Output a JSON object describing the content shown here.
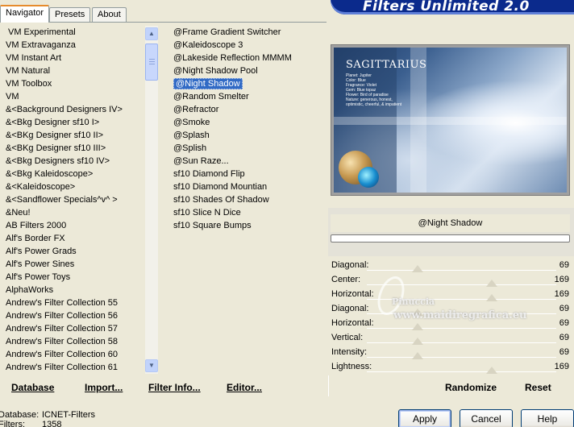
{
  "window": {
    "title": "Filters Unlimited 2.0"
  },
  "tabs": [
    {
      "label": "Navigator",
      "active": true
    },
    {
      "label": "Presets",
      "active": false
    },
    {
      "label": "About",
      "active": false
    }
  ],
  "categories": {
    "selected": "&<Background Designers IV>",
    "items": [
      "VM Experimental",
      "VM Extravaganza",
      "VM Instant Art",
      "VM Natural",
      "VM Toolbox",
      "VM",
      "&<Background Designers IV>",
      "&<Bkg Designer sf10 I>",
      "&<BKg Designer sf10 II>",
      "&<BKg Designer sf10 III>",
      "&<Bkg Designers sf10 IV>",
      "&<Bkg Kaleidoscope>",
      "&<Kaleidoscope>",
      "&<Sandflower Specials^v^ >",
      "&Neu!",
      "AB Filters 2000",
      "Alf's Border FX",
      "Alf's Power Grads",
      "Alf's Power Sines",
      "Alf's Power Toys",
      "AlphaWorks",
      "Andrew's Filter Collection 55",
      "Andrew's Filter Collection 56",
      "Andrew's Filter Collection 57",
      "Andrew's Filter Collection 58",
      "Andrew's Filter Collection 60",
      "Andrew's Filter Collection 61"
    ]
  },
  "filters": {
    "selected": "@Night Shadow",
    "items": [
      "@Frame Gradient Switcher",
      "@Kaleidoscope 3",
      "@Lakeside Reflection MMMM",
      "@Night Shadow Pool",
      "@Night Shadow",
      "@Random Smelter",
      "@Refractor",
      "@Smoke",
      "@Splash",
      "@Splish",
      "@Sun Raze...",
      "sf10 Diamond Flip",
      "sf10 Diamond Mountian",
      "sf10 Shades Of Shadow",
      "sf10 Slice N Dice",
      "sf10 Square Bumps"
    ]
  },
  "preview": {
    "title": "SAGITTARIUS",
    "text_lines": [
      "Planet: Jupiter",
      "Color: Blue",
      "Fragrance: Violet",
      "Gem: Blue topaz",
      "Flower: Bird of paradise",
      "Nature: generous, honest,",
      "optimistic, cheerful, & impatient"
    ]
  },
  "current_filter": "@Night Shadow",
  "progress": 0,
  "parameters": [
    {
      "label": "Diagonal:",
      "value": "69",
      "fraction": 0.27
    },
    {
      "label": "Center:",
      "value": "169",
      "fraction": 0.66
    },
    {
      "label": "Horizontal:",
      "value": "169",
      "fraction": 0.66
    },
    {
      "label": "Diagonal:",
      "value": "69",
      "fraction": 0.27
    },
    {
      "label": "Horizontal:",
      "value": "69",
      "fraction": 0.27
    },
    {
      "label": "Vertical:",
      "value": "69",
      "fraction": 0.27
    },
    {
      "label": "Intensity:",
      "value": "69",
      "fraction": 0.27
    },
    {
      "label": "Lightness:",
      "value": "169",
      "fraction": 0.66
    }
  ],
  "toolbar": {
    "database": "Database",
    "import": "Import...",
    "filter_info": "Filter Info...",
    "editor": "Editor...",
    "randomize": "Randomize",
    "reset": "Reset"
  },
  "status": {
    "database_label": "Database:",
    "database_value": "ICNET-Filters",
    "filters_label": "Filters:",
    "filters_value": "1358"
  },
  "buttons": {
    "apply": "Apply",
    "cancel": "Cancel",
    "help": "Help"
  },
  "watermark": {
    "name": "Pinuccia",
    "url": "www.maidiregrafica.eu"
  }
}
